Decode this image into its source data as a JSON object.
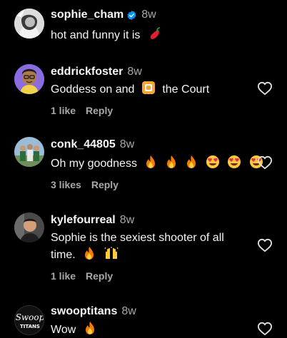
{
  "comments": [
    {
      "username": "sophie_cham",
      "verified": true,
      "time": "8w",
      "text_before": "hot and funny it is",
      "text_after": "",
      "likes": "",
      "reply": ""
    },
    {
      "username": "eddrickfoster",
      "verified": false,
      "time": "8w",
      "text_before": "Goddess on and",
      "text_after": "the Court",
      "likes": "1 like",
      "reply": "Reply"
    },
    {
      "username": "conk_44805",
      "verified": false,
      "time": "8w",
      "text_before": "Oh my goodness",
      "text_after": "",
      "likes": "3 likes",
      "reply": "Reply"
    },
    {
      "username": "kylefourreal",
      "verified": false,
      "time": "8w",
      "text_line1": "Sophie is the sexiest shooter of all",
      "text_line2": "time.",
      "likes": "1 like",
      "reply": "Reply"
    },
    {
      "username": "swooptitans",
      "verified": false,
      "time": "8w",
      "text_before": "Wow",
      "text_after": "",
      "likes": "",
      "reply": ""
    }
  ],
  "avatar_logo": {
    "line1": "Swoop",
    "line2": "TITANS"
  },
  "icons": {
    "verified": "verified-badge-icon",
    "heart": "heart-outline-icon"
  },
  "colors": {
    "background": "#000000",
    "text": "#f5f5f5",
    "muted": "#a8a8a8",
    "verified": "#0095f6"
  }
}
